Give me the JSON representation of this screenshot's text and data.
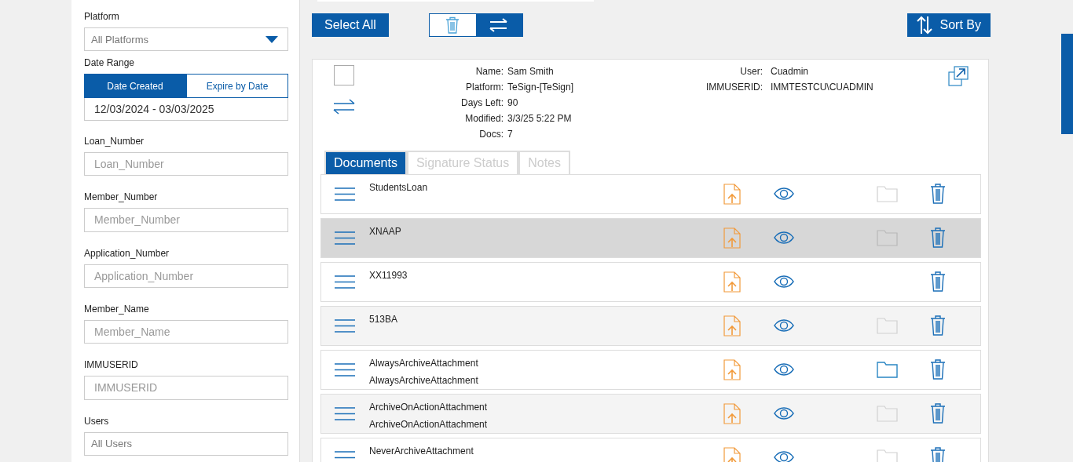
{
  "filters": {
    "platform": {
      "label": "Platform",
      "value": "All Platforms"
    },
    "date_range": {
      "label": "Date Range",
      "tabs": [
        {
          "label": "Date Created",
          "selected": true
        },
        {
          "label": "Expire by Date",
          "selected": false
        }
      ],
      "value": "12/03/2024 - 03/03/2025"
    },
    "fields": [
      {
        "label": "Loan_Number",
        "placeholder": "Loan_Number"
      },
      {
        "label": "Member_Number",
        "placeholder": "Member_Number"
      },
      {
        "label": "Application_Number",
        "placeholder": "Application_Number"
      },
      {
        "label": "Member_Name",
        "placeholder": "Member_Name"
      },
      {
        "label": "IMMUSERID",
        "placeholder": "IMMUSERID"
      }
    ],
    "users": {
      "label": "Users",
      "value": "All Users"
    }
  },
  "toolbar": {
    "select_all": "Select All",
    "view_toggle": [
      {
        "kind": "trash",
        "selected": false
      },
      {
        "kind": "swap",
        "selected": true
      }
    ],
    "sort": "Sort By"
  },
  "package": {
    "checked": false,
    "info": [
      {
        "label": "Name:",
        "value": "Sam Smith"
      },
      {
        "label": "Platform:",
        "value": "TeSign-[TeSign]"
      },
      {
        "label": "Days Left:",
        "value": "90"
      },
      {
        "label": "Modified:",
        "value": "3/3/25 5:22 PM"
      },
      {
        "label": "Docs:",
        "value": "7"
      }
    ],
    "info_right": [
      {
        "label": "User:",
        "value": "Cuadmin"
      },
      {
        "label": "IMMUSERID:",
        "value": "IMMTESTCU\\CUADMIN"
      }
    ],
    "tabs": [
      {
        "label": "Documents",
        "selected": true
      },
      {
        "label": "Signature Status",
        "selected": false
      },
      {
        "label": "Notes",
        "selected": false
      }
    ],
    "documents": [
      {
        "lines": [
          "StudentsLoan"
        ],
        "selected": false,
        "has_folder": true,
        "archived": false
      },
      {
        "lines": [
          "XNAAP"
        ],
        "selected": true,
        "has_folder": true,
        "archived": false
      },
      {
        "lines": [
          "XX11993"
        ],
        "selected": false,
        "has_folder": false
      },
      {
        "lines": [
          "513BA"
        ],
        "selected": false,
        "has_folder": true,
        "archived": false
      },
      {
        "lines": [
          "AlwaysArchiveAttachment",
          "AlwaysArchiveAttachment"
        ],
        "selected": false,
        "has_folder": true,
        "archived": true
      },
      {
        "lines": [
          "ArchiveOnActionAttachment",
          "ArchiveOnActionAttachment"
        ],
        "selected": false,
        "has_folder": true,
        "archived": false
      },
      {
        "lines": [
          "NeverArchiveAttachment"
        ],
        "selected": false,
        "has_folder": true,
        "archived": false
      }
    ]
  }
}
